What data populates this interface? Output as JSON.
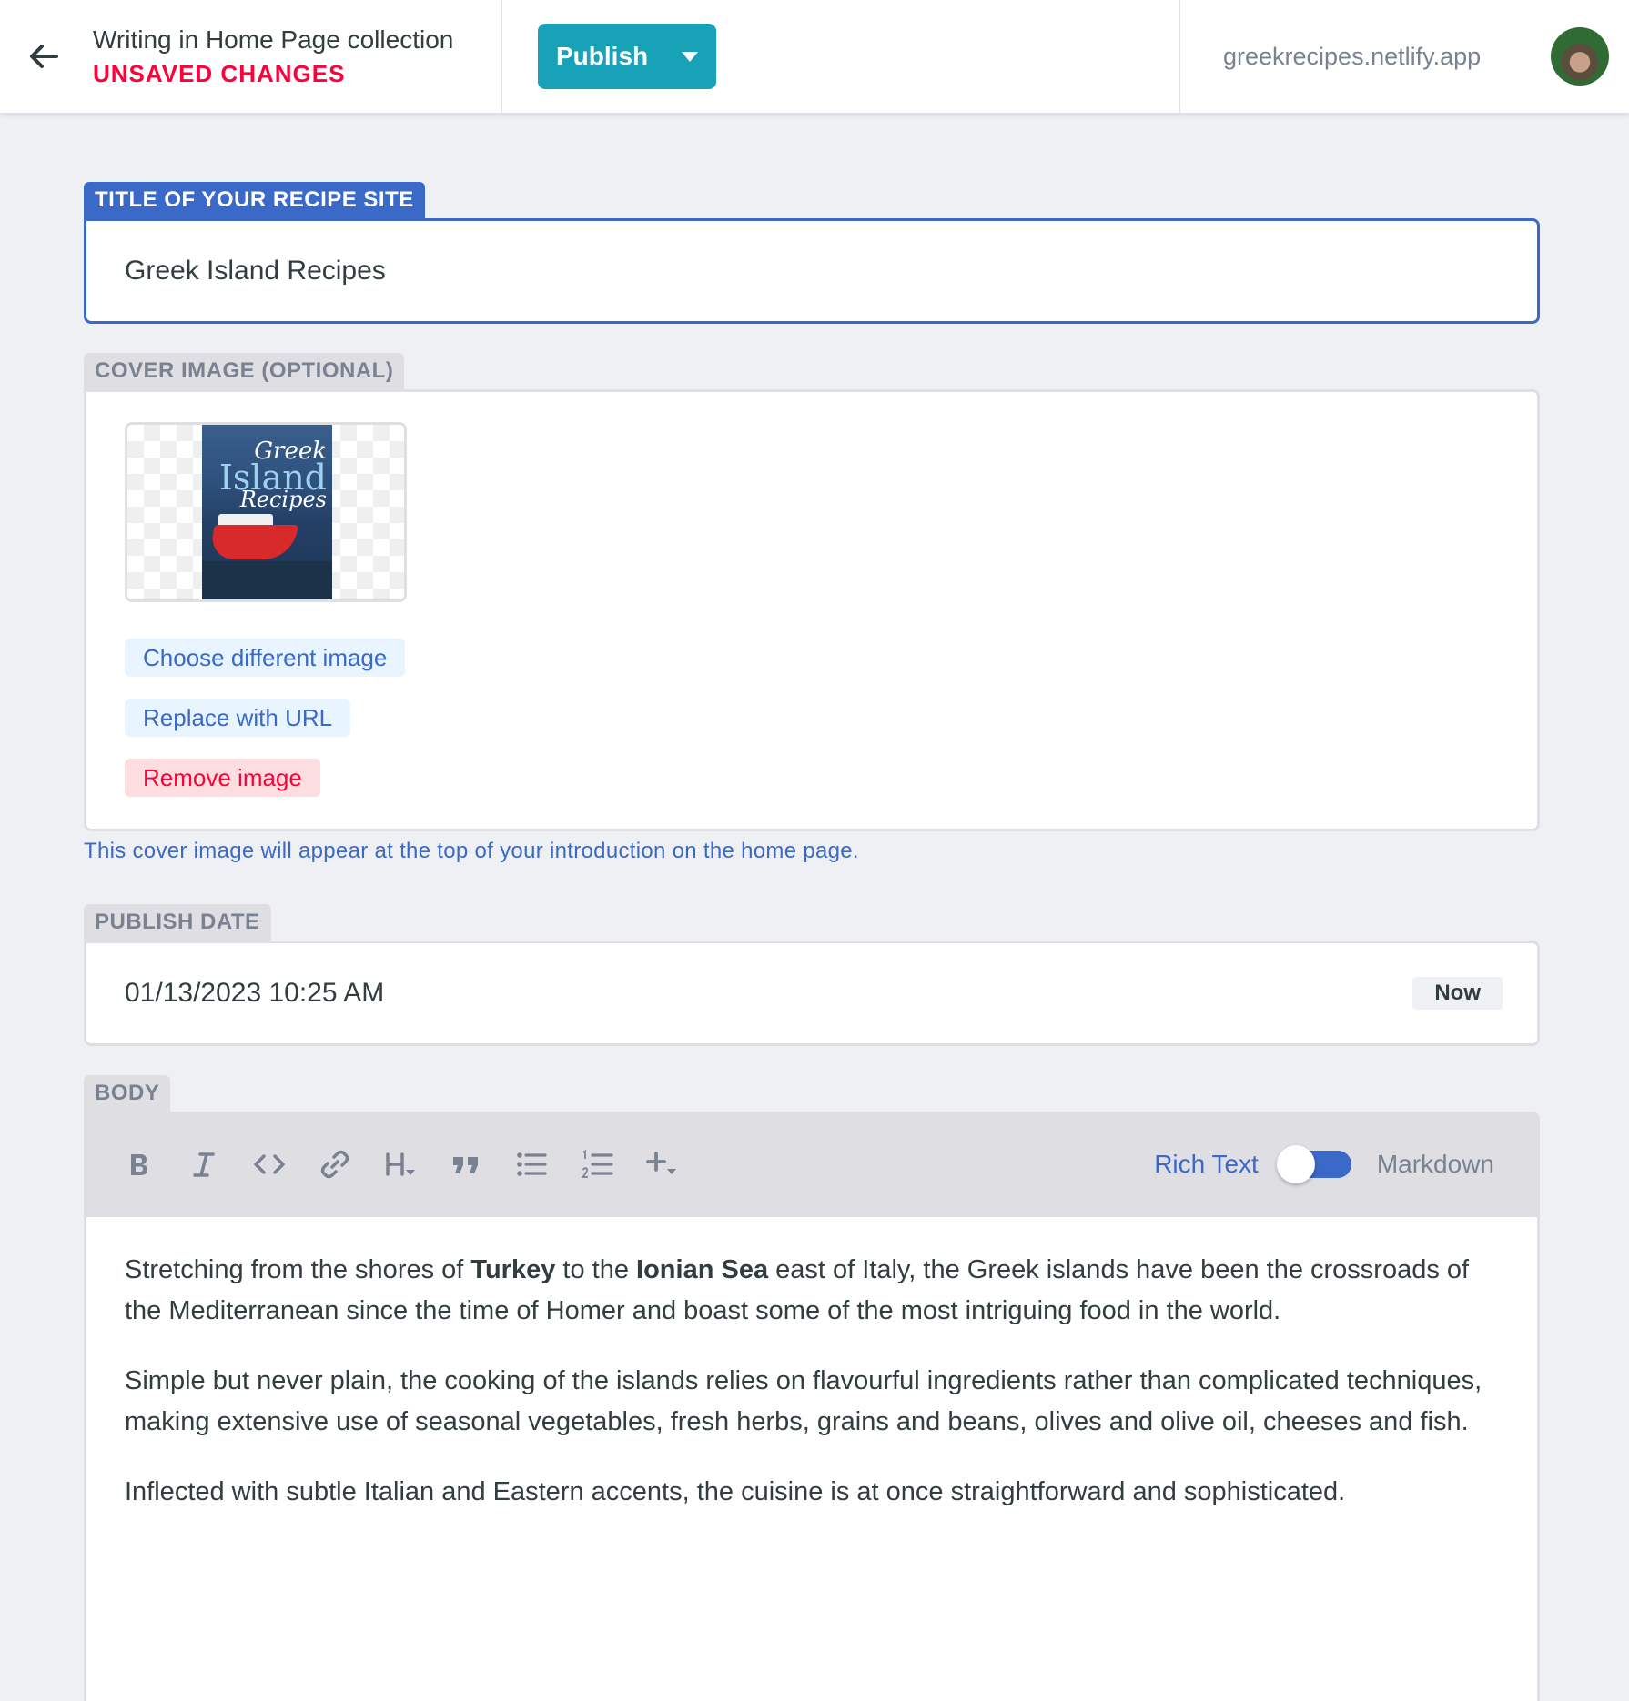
{
  "header": {
    "collection_label": "Writing in Home Page collection",
    "status": "UNSAVED CHANGES",
    "publish_label": "Publish",
    "site_url": "greekrecipes.netlify.app"
  },
  "fields": {
    "title": {
      "label": "TITLE OF YOUR RECIPE SITE",
      "value": "Greek Island Recipes"
    },
    "cover": {
      "label": "COVER IMAGE (OPTIONAL)",
      "image_title_lines": [
        "Greek",
        "Island",
        "Recipes"
      ],
      "choose_label": "Choose different image",
      "replace_label": "Replace with URL",
      "remove_label": "Remove image",
      "hint": "This cover image will appear at the top of your introduction on the home page."
    },
    "publish_date": {
      "label": "PUBLISH DATE",
      "value": "01/13/2023 10:25 AM",
      "now_label": "Now"
    },
    "body": {
      "label": "BODY",
      "mode_rich": "Rich Text",
      "mode_markdown": "Markdown",
      "p1_a": "Stretching from the shores of ",
      "p1_b": "Turkey",
      "p1_c": " to the ",
      "p1_d": "Ionian Sea",
      "p1_e": " east of Italy, the Greek islands have been the crossroads of the Mediterranean since the time of Homer and boast some of the most intriguing food in the world.",
      "p2": "Simple but never plain, the cooking of the islands relies on flavourful ingredients rather than complicated techniques, making extensive use of seasonal vegetables, fresh herbs, grains and beans, olives and olive oil, cheeses and fish.",
      "p3": "Inflected with subtle Italian and Eastern accents, the cuisine is at once straightforward and sophisticated."
    }
  },
  "colors": {
    "accent": "#3a69c7",
    "publish": "#17a2b8",
    "danger": "#ff003b"
  }
}
